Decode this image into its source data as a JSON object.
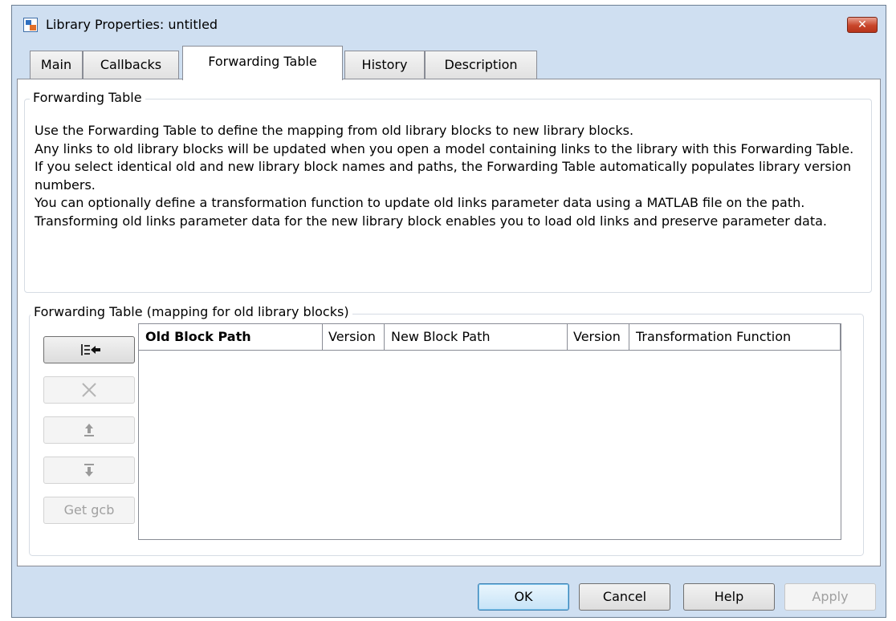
{
  "window": {
    "title": "Library Properties: untitled",
    "close_glyph": "✕"
  },
  "tabs": [
    {
      "label": "Main"
    },
    {
      "label": "Callbacks"
    },
    {
      "label": "Forwarding Table",
      "active": true
    },
    {
      "label": "History"
    },
    {
      "label": "Description"
    }
  ],
  "info_group": {
    "title": "Forwarding Table",
    "paragraphs": [
      "Use the Forwarding Table to define the mapping from old library blocks to new library blocks.",
      "Any links to old library blocks will be updated when you open a model containing links to the library with this Forwarding Table.",
      "If you select identical old and new library block names and paths, the Forwarding Table automatically populates library version numbers.",
      "You can optionally define a transformation function to update old links parameter data using a MATLAB file on the path. Transforming old links parameter data for the new library block enables you to load old links and preserve parameter data."
    ]
  },
  "mapping_group": {
    "title": "Forwarding Table (mapping for old library blocks)",
    "buttons": {
      "add_icon": "add-row-icon",
      "delete_icon": "delete-icon",
      "move_up_icon": "move-up-icon",
      "move_down_icon": "move-down-icon",
      "get_gcb_label": "Get gcb"
    },
    "columns": [
      "Old Block Path",
      "Version",
      "New Block Path",
      "Version",
      "Transformation Function"
    ],
    "rows": []
  },
  "footer": {
    "ok": "OK",
    "cancel": "Cancel",
    "help": "Help",
    "apply": "Apply"
  },
  "colors": {
    "window_frame": "#cfdff1",
    "close_button": "#c8452a"
  }
}
